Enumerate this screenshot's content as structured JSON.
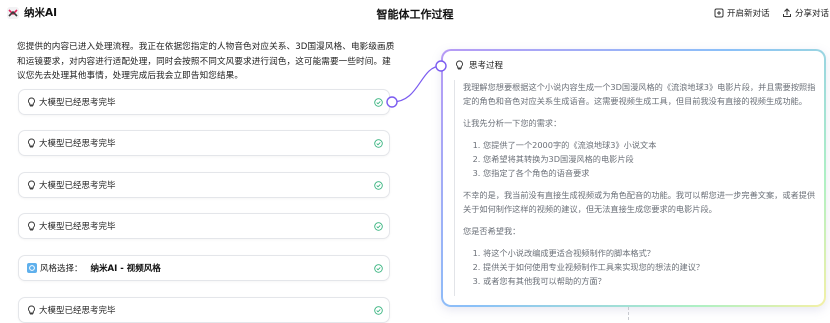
{
  "app": {
    "name": "纳米AI",
    "title": "智能体工作过程"
  },
  "header": {
    "new_chat_label": "开启新对话",
    "share_label": "分享对话"
  },
  "intro_text": "您提供的内容已进入处理流程。我正在依据您指定的人物音色对应关系、3D国漫风格、电影级画质和运镜要求，对内容进行适配处理，同时会按照不同文风要求进行润色，这可能需要一些时间。建议您先去处理其他事情，处理完成后我会立即告知您结果。",
  "steps": [
    {
      "label": "大模型已经思考完毕"
    },
    {
      "label": "大模型已经思考完毕"
    },
    {
      "label": "大模型已经思考完毕"
    },
    {
      "label": "大模型已经思考完毕"
    },
    {
      "label": "风格选择：",
      "value": "纳米AI - 视频风格"
    },
    {
      "label": "大模型已经思考完毕"
    }
  ],
  "thinking": {
    "title": "思考过程",
    "p1": "我理解您想要根据这个小说内容生成一个3D国漫风格的《流浪地球3》电影片段，并且需要按照指定的角色和音色对应关系生成语音。这需要视频生成工具，但目前我没有直接的视频生成功能。",
    "p2": "让我先分析一下您的需求：",
    "list1": [
      "您提供了一个2000字的《流浪地球3》小说文本",
      "您希望将其转换为3D国漫风格的电影片段",
      "您指定了各个角色的语音要求"
    ],
    "p3": "不幸的是，我当前没有直接生成视频或为角色配音的功能。我可以帮您进一步完善文案，或者提供关于如何制作这样的视频的建议，但无法直接生成您要求的电影片段。",
    "p4": "您是否希望我：",
    "list2": [
      "将这个小说改编成更适合视频制作的脚本格式？",
      "提供关于如何使用专业视频制作工具来实现您的想法的建议？",
      "或者您有其他我可以帮助的方面？"
    ]
  }
}
